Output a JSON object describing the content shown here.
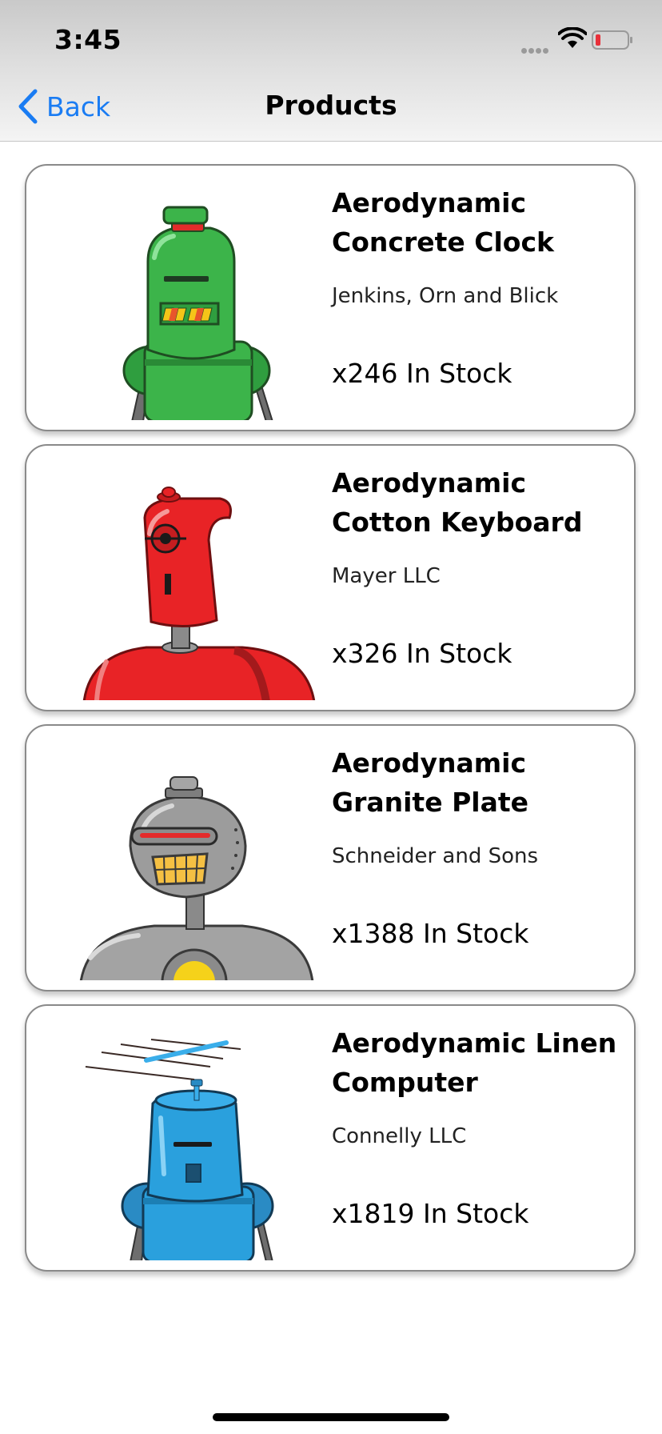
{
  "status_bar": {
    "time": "3:45"
  },
  "nav": {
    "back_label": "Back",
    "title": "Products"
  },
  "colors": {
    "accent": "#1a7cf3",
    "battery_low": "#e8303a"
  },
  "products": [
    {
      "name": "Aerodynamic Concrete Clock",
      "brand": "Jenkins, Orn and Blick",
      "stock": "x246 In Stock",
      "robot_icon": "green-robot-icon"
    },
    {
      "name": "Aerodynamic Cotton Keyboard",
      "brand": "Mayer LLC",
      "stock": "x326 In Stock",
      "robot_icon": "red-robot-icon"
    },
    {
      "name": "Aerodynamic Granite Plate",
      "brand": "Schneider and Sons",
      "stock": "x1388 In Stock",
      "robot_icon": "gray-robot-icon"
    },
    {
      "name": "Aerodynamic Linen Computer",
      "brand": "Connelly LLC",
      "stock": "x1819 In Stock",
      "robot_icon": "blue-robot-icon"
    }
  ]
}
